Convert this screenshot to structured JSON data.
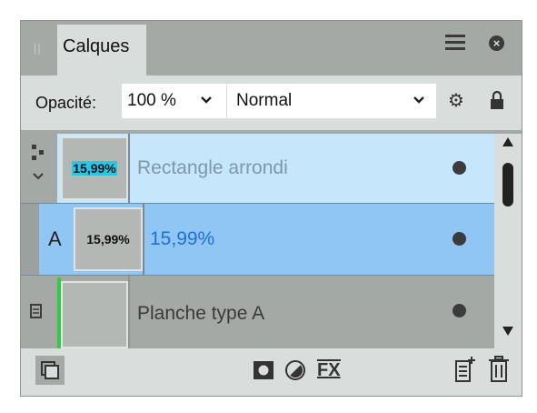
{
  "panel": {
    "tab_label": "Calques",
    "grip": "||"
  },
  "options": {
    "opacity_label": "Opacité:",
    "opacity_value": "100 %",
    "blend_mode": "Normal"
  },
  "layers": [
    {
      "name": "Rectangle arrondi",
      "thumb_text": "15,99%",
      "selected": false
    },
    {
      "name": "15,99%",
      "badge": "A",
      "thumb_text": "15,99%",
      "selected": true
    },
    {
      "name": "Planche type A",
      "thumb_text": "",
      "selected": false
    }
  ],
  "icons": {
    "menu": "hamburger-icon",
    "close": "close-icon",
    "settings": "gear-icon",
    "lock": "lock-icon",
    "visibility": "dot-icon",
    "fx": "FX"
  },
  "colors": {
    "panel_bg": "#a4a9a6",
    "light_bg": "#d9dddb",
    "selected_row": "#8fc6f4",
    "hover_row": "#c6e6fb",
    "accent_green": "#2ecc40"
  }
}
